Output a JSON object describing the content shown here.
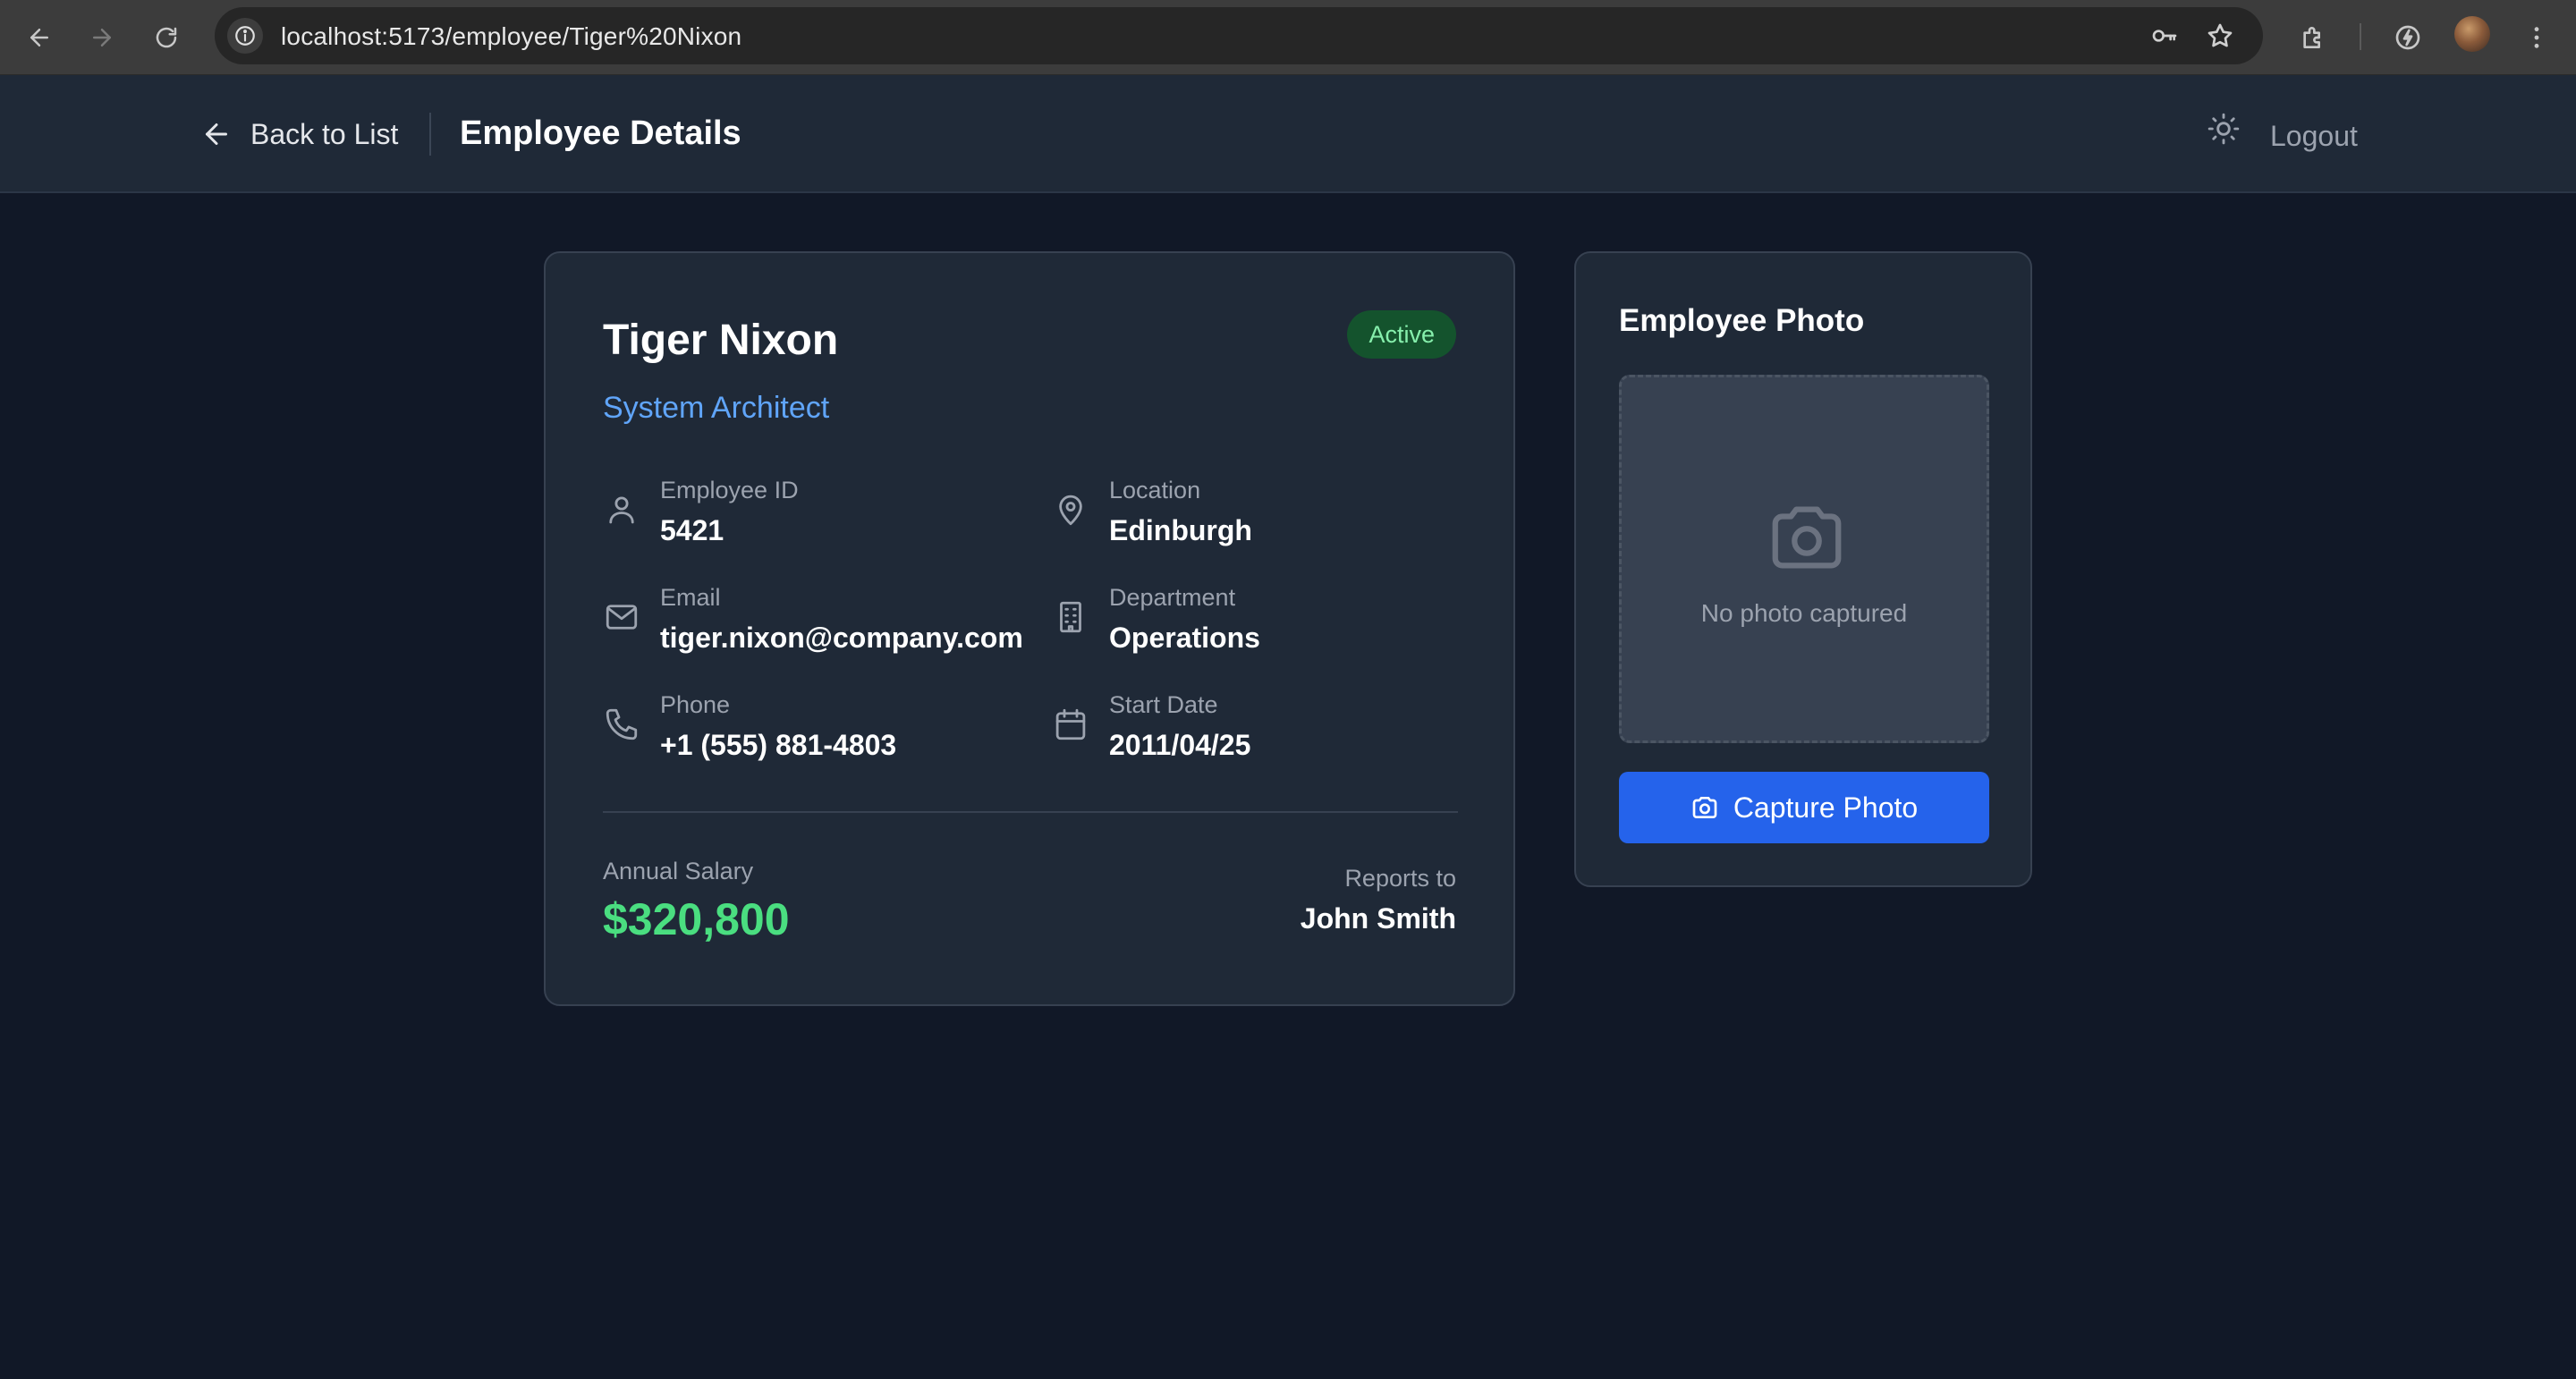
{
  "browser": {
    "url": "localhost:5173/employee/Tiger%20Nixon",
    "icons": [
      "back-icon",
      "forward-icon",
      "reload-icon",
      "site-info-icon",
      "key-icon",
      "star-icon",
      "extensions-icon",
      "performance-icon",
      "profile-avatar",
      "menu-icon"
    ]
  },
  "header": {
    "back_label": "Back to List",
    "title": "Employee Details",
    "logout_label": "Logout"
  },
  "employee": {
    "name": "Tiger Nixon",
    "position": "System Architect",
    "status": "Active",
    "fields": {
      "employee_id": {
        "label": "Employee ID",
        "value": "5421"
      },
      "location": {
        "label": "Location",
        "value": "Edinburgh"
      },
      "email": {
        "label": "Email",
        "value": "tiger.nixon@company.com"
      },
      "department": {
        "label": "Department",
        "value": "Operations"
      },
      "phone": {
        "label": "Phone",
        "value": "+1 (555) 881-4803"
      },
      "start_date": {
        "label": "Start Date",
        "value": "2011/04/25"
      }
    },
    "salary_label": "Annual Salary",
    "salary": "$320,800",
    "reports_label": "Reports to",
    "reports_to": "John Smith"
  },
  "photo": {
    "title": "Employee Photo",
    "empty_text": "No photo captured",
    "capture_label": "Capture Photo"
  },
  "colors": {
    "background": "#111827",
    "card": "#1f2937",
    "accent_blue": "#60a5fa",
    "salary_green": "#4ade80",
    "button_blue": "#2563eb",
    "badge_bg": "#14532d",
    "badge_text": "#86efac"
  }
}
